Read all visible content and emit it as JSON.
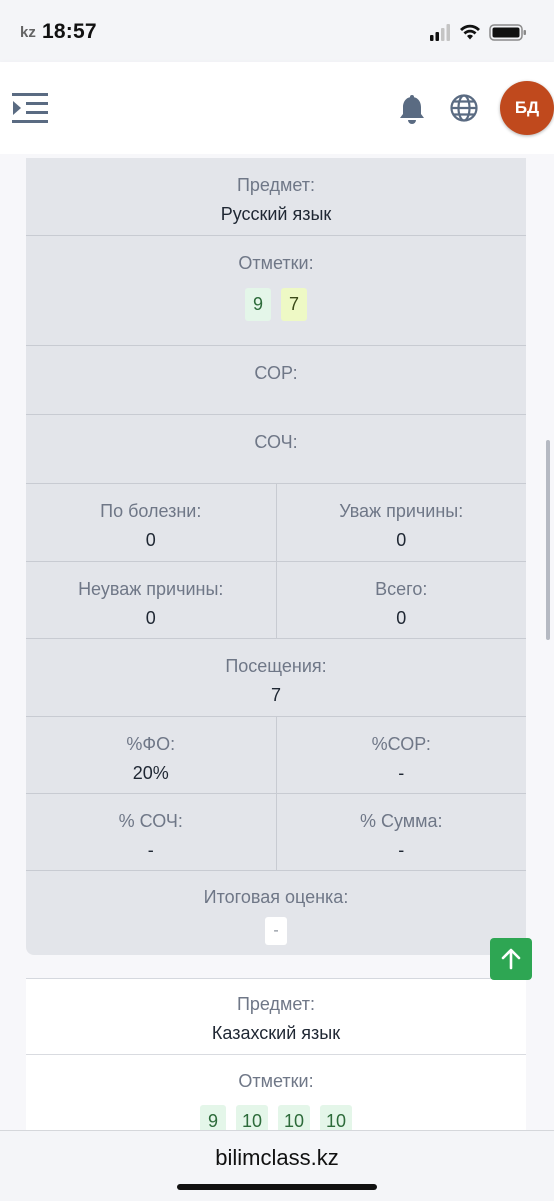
{
  "status": {
    "time": "18:57",
    "watermark": "kz"
  },
  "header": {
    "avatar_initials": "БД"
  },
  "subject1": {
    "subject_label": "Предмет:",
    "subject_name": "Русский язык",
    "marks_label": "Отметки:",
    "marks": [
      "9",
      "7"
    ],
    "sor_label": "СОР:",
    "soch_label": "СОЧ:",
    "illness_label": "По болезни:",
    "illness_value": "0",
    "excused_label": "Уваж причины:",
    "excused_value": "0",
    "unexcused_label": "Неуваж причины:",
    "unexcused_value": "0",
    "total_label": "Всего:",
    "total_value": "0",
    "attendance_label": "Посещения:",
    "attendance_value": "7",
    "fo_label": "%ФО:",
    "fo_value": "20%",
    "sor_pct_label": "%СОР:",
    "sor_pct_value": "-",
    "soch_pct_label": "% СОЧ:",
    "soch_pct_value": "-",
    "sum_pct_label": "% Сумма:",
    "sum_pct_value": "-",
    "final_label": "Итоговая оценка:",
    "final_value": "-"
  },
  "subject2": {
    "subject_label": "Предмет:",
    "subject_name": "Казахский язык",
    "marks_label": "Отметки:",
    "marks": [
      "9",
      "10",
      "10",
      "10"
    ]
  },
  "browser": {
    "url": "bilimclass.kz"
  },
  "icons": {
    "menu": "menu-indent-icon",
    "bell": "bell-icon",
    "globe": "globe-icon",
    "arrow_up": "arrow-up-icon"
  },
  "colors": {
    "avatar": "#c0491d",
    "to_top_button": "#2ea653",
    "mark_green_bg": "#e4f6e9",
    "mark_yellow_bg": "#eef9c5"
  }
}
